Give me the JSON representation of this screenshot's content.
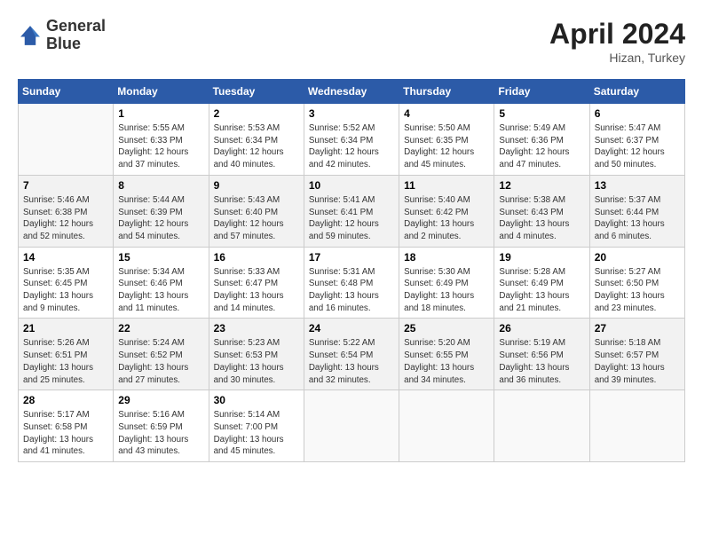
{
  "header": {
    "logo_line1": "General",
    "logo_line2": "Blue",
    "month_year": "April 2024",
    "location": "Hizan, Turkey"
  },
  "days_of_week": [
    "Sunday",
    "Monday",
    "Tuesday",
    "Wednesday",
    "Thursday",
    "Friday",
    "Saturday"
  ],
  "weeks": [
    [
      {
        "day": "",
        "info": ""
      },
      {
        "day": "1",
        "info": "Sunrise: 5:55 AM\nSunset: 6:33 PM\nDaylight: 12 hours\nand 37 minutes."
      },
      {
        "day": "2",
        "info": "Sunrise: 5:53 AM\nSunset: 6:34 PM\nDaylight: 12 hours\nand 40 minutes."
      },
      {
        "day": "3",
        "info": "Sunrise: 5:52 AM\nSunset: 6:34 PM\nDaylight: 12 hours\nand 42 minutes."
      },
      {
        "day": "4",
        "info": "Sunrise: 5:50 AM\nSunset: 6:35 PM\nDaylight: 12 hours\nand 45 minutes."
      },
      {
        "day": "5",
        "info": "Sunrise: 5:49 AM\nSunset: 6:36 PM\nDaylight: 12 hours\nand 47 minutes."
      },
      {
        "day": "6",
        "info": "Sunrise: 5:47 AM\nSunset: 6:37 PM\nDaylight: 12 hours\nand 50 minutes."
      }
    ],
    [
      {
        "day": "7",
        "info": "Sunrise: 5:46 AM\nSunset: 6:38 PM\nDaylight: 12 hours\nand 52 minutes."
      },
      {
        "day": "8",
        "info": "Sunrise: 5:44 AM\nSunset: 6:39 PM\nDaylight: 12 hours\nand 54 minutes."
      },
      {
        "day": "9",
        "info": "Sunrise: 5:43 AM\nSunset: 6:40 PM\nDaylight: 12 hours\nand 57 minutes."
      },
      {
        "day": "10",
        "info": "Sunrise: 5:41 AM\nSunset: 6:41 PM\nDaylight: 12 hours\nand 59 minutes."
      },
      {
        "day": "11",
        "info": "Sunrise: 5:40 AM\nSunset: 6:42 PM\nDaylight: 13 hours\nand 2 minutes."
      },
      {
        "day": "12",
        "info": "Sunrise: 5:38 AM\nSunset: 6:43 PM\nDaylight: 13 hours\nand 4 minutes."
      },
      {
        "day": "13",
        "info": "Sunrise: 5:37 AM\nSunset: 6:44 PM\nDaylight: 13 hours\nand 6 minutes."
      }
    ],
    [
      {
        "day": "14",
        "info": "Sunrise: 5:35 AM\nSunset: 6:45 PM\nDaylight: 13 hours\nand 9 minutes."
      },
      {
        "day": "15",
        "info": "Sunrise: 5:34 AM\nSunset: 6:46 PM\nDaylight: 13 hours\nand 11 minutes."
      },
      {
        "day": "16",
        "info": "Sunrise: 5:33 AM\nSunset: 6:47 PM\nDaylight: 13 hours\nand 14 minutes."
      },
      {
        "day": "17",
        "info": "Sunrise: 5:31 AM\nSunset: 6:48 PM\nDaylight: 13 hours\nand 16 minutes."
      },
      {
        "day": "18",
        "info": "Sunrise: 5:30 AM\nSunset: 6:49 PM\nDaylight: 13 hours\nand 18 minutes."
      },
      {
        "day": "19",
        "info": "Sunrise: 5:28 AM\nSunset: 6:49 PM\nDaylight: 13 hours\nand 21 minutes."
      },
      {
        "day": "20",
        "info": "Sunrise: 5:27 AM\nSunset: 6:50 PM\nDaylight: 13 hours\nand 23 minutes."
      }
    ],
    [
      {
        "day": "21",
        "info": "Sunrise: 5:26 AM\nSunset: 6:51 PM\nDaylight: 13 hours\nand 25 minutes."
      },
      {
        "day": "22",
        "info": "Sunrise: 5:24 AM\nSunset: 6:52 PM\nDaylight: 13 hours\nand 27 minutes."
      },
      {
        "day": "23",
        "info": "Sunrise: 5:23 AM\nSunset: 6:53 PM\nDaylight: 13 hours\nand 30 minutes."
      },
      {
        "day": "24",
        "info": "Sunrise: 5:22 AM\nSunset: 6:54 PM\nDaylight: 13 hours\nand 32 minutes."
      },
      {
        "day": "25",
        "info": "Sunrise: 5:20 AM\nSunset: 6:55 PM\nDaylight: 13 hours\nand 34 minutes."
      },
      {
        "day": "26",
        "info": "Sunrise: 5:19 AM\nSunset: 6:56 PM\nDaylight: 13 hours\nand 36 minutes."
      },
      {
        "day": "27",
        "info": "Sunrise: 5:18 AM\nSunset: 6:57 PM\nDaylight: 13 hours\nand 39 minutes."
      }
    ],
    [
      {
        "day": "28",
        "info": "Sunrise: 5:17 AM\nSunset: 6:58 PM\nDaylight: 13 hours\nand 41 minutes."
      },
      {
        "day": "29",
        "info": "Sunrise: 5:16 AM\nSunset: 6:59 PM\nDaylight: 13 hours\nand 43 minutes."
      },
      {
        "day": "30",
        "info": "Sunrise: 5:14 AM\nSunset: 7:00 PM\nDaylight: 13 hours\nand 45 minutes."
      },
      {
        "day": "",
        "info": ""
      },
      {
        "day": "",
        "info": ""
      },
      {
        "day": "",
        "info": ""
      },
      {
        "day": "",
        "info": ""
      }
    ]
  ]
}
